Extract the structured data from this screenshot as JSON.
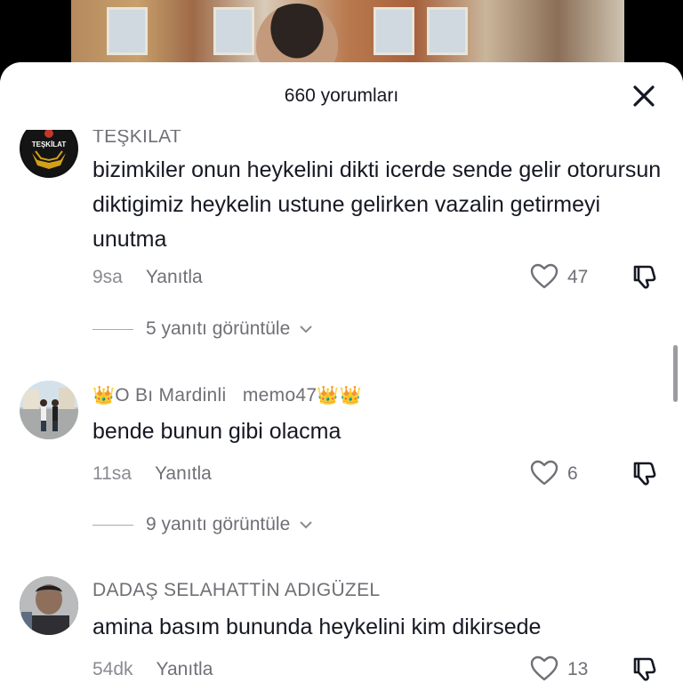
{
  "sheet": {
    "title": "660 yorumları"
  },
  "comments": [
    {
      "username": "TEŞKILAT",
      "text": "bizimkiler onun heykelini dikti icerde sende gelir otorursun diktigimiz heykelin ustune gelirken vazalin getirmeyi unutma",
      "time": "9sa",
      "reply_label": "Yanıtla",
      "likes": "47",
      "view_replies": "5 yanıtı görüntüle"
    },
    {
      "username_main": "O Bı Mardinli",
      "username_handle": "memo47",
      "text": "bende bunun gibi olacma",
      "time": "11sa",
      "reply_label": "Yanıtla",
      "likes": "6",
      "view_replies": "9 yanıtı görüntüle"
    },
    {
      "username": "DADAŞ  SELAHATTİN ADIGÜZEL",
      "text": "amina basım bununda heykelini kim dikirsede",
      "time": "54dk",
      "reply_label": "Yanıtla",
      "likes": "13"
    }
  ],
  "avatar_labels": {
    "teskilat": "TEŞKİLAT"
  },
  "icons": {
    "close": "close-icon",
    "like": "heart-outline-icon",
    "dislike": "thumbs-down-icon",
    "chevron": "chevron-down-icon",
    "crown": "crown-emoji"
  },
  "colors": {
    "text": "#161823",
    "muted": "#8a8b91",
    "sheet": "#ffffff"
  }
}
